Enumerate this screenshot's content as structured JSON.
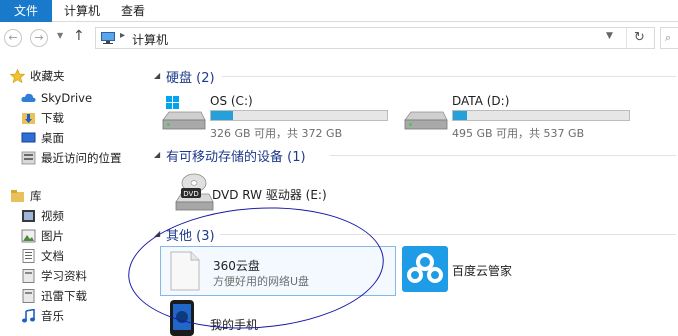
{
  "ribbon": {
    "tabs": [
      {
        "label": "文件"
      },
      {
        "label": "计算机"
      },
      {
        "label": "查看"
      }
    ]
  },
  "address": {
    "path": "计算机",
    "separator": "▸"
  },
  "sidebar": {
    "favorites_label": "收藏夹",
    "favorites": [
      {
        "label": "SkyDrive",
        "icon": "cloud-icon"
      },
      {
        "label": "下载",
        "icon": "download-folder-icon"
      },
      {
        "label": "桌面",
        "icon": "desktop-icon"
      },
      {
        "label": "最近访问的位置",
        "icon": "recent-places-icon"
      }
    ],
    "library_label": "库",
    "libraries": [
      {
        "label": "视频",
        "icon": "video-icon"
      },
      {
        "label": "图片",
        "icon": "picture-icon"
      },
      {
        "label": "文档",
        "icon": "document-icon"
      },
      {
        "label": "学习资料",
        "icon": "library-folder-icon"
      },
      {
        "label": "迅雷下载",
        "icon": "library-folder-icon"
      },
      {
        "label": "音乐",
        "icon": "music-icon"
      }
    ]
  },
  "groups": {
    "hard_disks": "硬盘 (2)",
    "removable": "有可移动存储的设备 (1)",
    "other": "其他 (3)"
  },
  "drives": [
    {
      "name": "OS (C:)",
      "size": "326 GB 可用，共 372 GB",
      "used_fraction": 0.124
    },
    {
      "name": "DATA (D:)",
      "size": "495 GB 可用，共 537 GB",
      "used_fraction": 0.078
    }
  ],
  "removable": [
    {
      "name": "DVD RW 驱动器 (E:)"
    }
  ],
  "other": [
    {
      "name": "360云盘",
      "subtitle": "方便好用的网络U盘"
    },
    {
      "name": "百度云管家"
    },
    {
      "name": "我的手机"
    }
  ],
  "colors": {
    "accent": "#1979ca",
    "group_title": "#1e3a8a",
    "drive_fill": "#26a0da",
    "annotation_circle": "#1a1aa8"
  }
}
